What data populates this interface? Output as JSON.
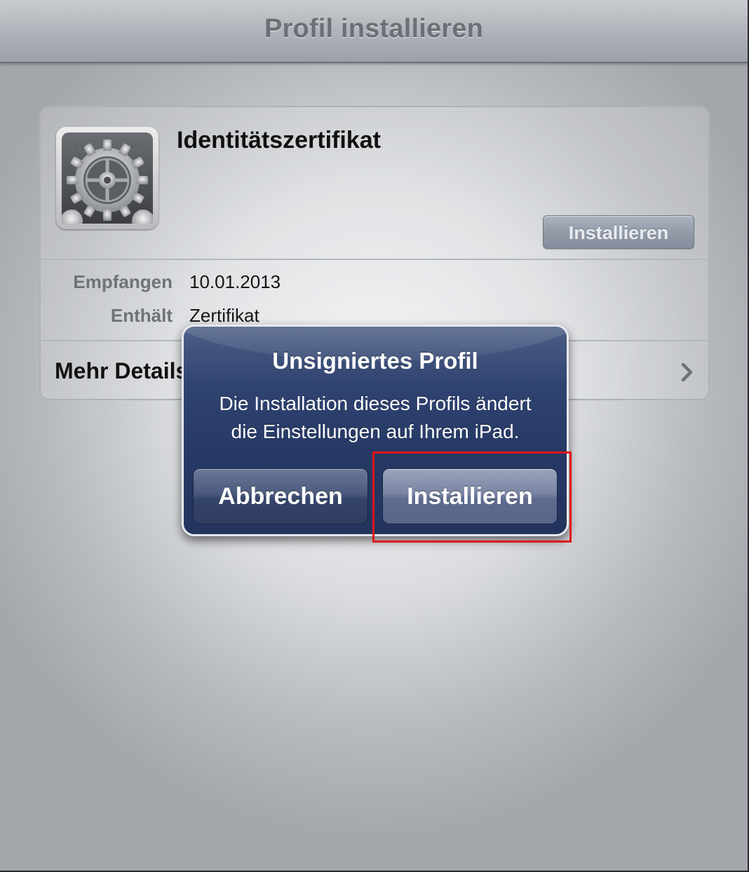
{
  "navbar": {
    "title": "Profil installieren"
  },
  "profile": {
    "icon": "settings-gear-icon",
    "name": "Identitätszertifikat",
    "install_label": "Installieren",
    "info": [
      {
        "label": "Empfangen",
        "value": "10.01.2013"
      },
      {
        "label": "Enthält",
        "value": "Zertifikat"
      }
    ],
    "details_label": "Mehr Details"
  },
  "alert": {
    "title": "Unsigniertes Profil",
    "message_line1": "Die Installation dieses Profils ändert",
    "message_line2": "die Einstellungen auf Ihrem iPad.",
    "cancel_label": "Abbrechen",
    "install_label": "Installieren"
  },
  "colors": {
    "highlight": "#e0131a",
    "alert_blue": "#273965"
  }
}
